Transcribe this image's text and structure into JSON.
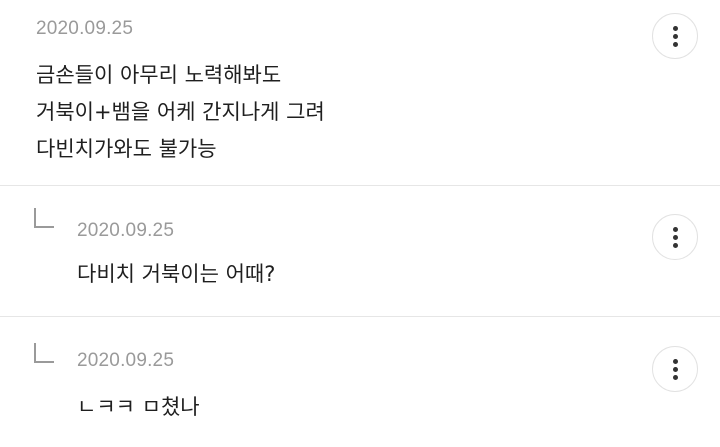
{
  "comments": [
    {
      "date": "2020.09.25",
      "lines": [
        "금손들이 아무리 노력해봐도",
        "거북이+뱀을 어케 간지나게 그려",
        "다빈치가와도 불가능"
      ],
      "more_icon": "more-vertical-icon"
    },
    {
      "date": "2020.09.25",
      "lines": [
        "다비치 거북이는 어때?"
      ],
      "is_reply": true,
      "reply_icon": "reply-arrow-icon",
      "more_icon": "more-vertical-icon"
    },
    {
      "date": "2020.09.25",
      "lines": [
        "ㄴㅋㅋ ㅁ쳤나"
      ],
      "is_reply": true,
      "reply_icon": "reply-arrow-icon",
      "more_icon": "more-vertical-icon"
    }
  ]
}
